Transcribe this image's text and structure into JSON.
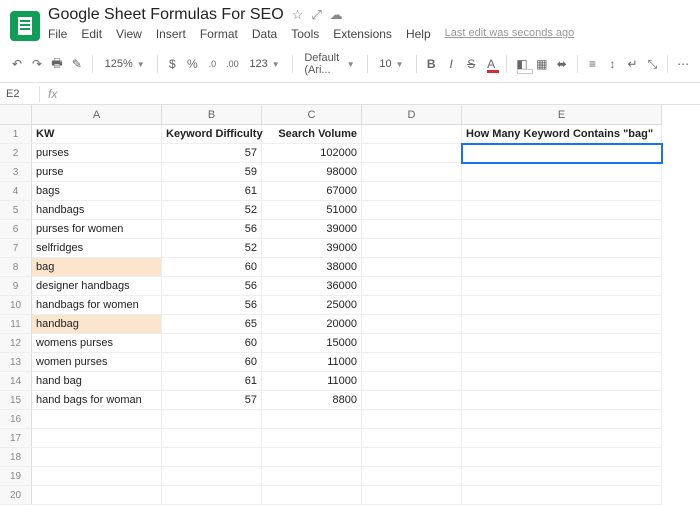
{
  "doc": {
    "title": "Google Sheet Formulas For SEO"
  },
  "menu": {
    "file": "File",
    "edit": "Edit",
    "view": "View",
    "insert": "Insert",
    "format": "Format",
    "data": "Data",
    "tools": "Tools",
    "extensions": "Extensions",
    "help": "Help",
    "last_edit": "Last edit was seconds ago"
  },
  "toolbar": {
    "zoom": "125%",
    "font": "Default (Ari...",
    "size": "10",
    "currency": "$",
    "percent": "%",
    "dec_dec": ".0",
    "inc_dec": ".00",
    "num_fmt": "123",
    "bold": "B",
    "italic": "I",
    "strike": "S",
    "text_color": "A"
  },
  "name_box": "E2",
  "fx": "fx",
  "columns": [
    "A",
    "B",
    "C",
    "D",
    "E"
  ],
  "headers": {
    "a": "KW",
    "b": "Keyword Difficulty",
    "c": "Search Volume",
    "e": "How Many Keyword Contains \"bag\""
  },
  "rows": [
    {
      "kw": "purses",
      "kd": "57",
      "sv": "102000"
    },
    {
      "kw": "purse",
      "kd": "59",
      "sv": "98000"
    },
    {
      "kw": "bags",
      "kd": "61",
      "sv": "67000"
    },
    {
      "kw": "handbags",
      "kd": "52",
      "sv": "51000"
    },
    {
      "kw": "purses for women",
      "kd": "56",
      "sv": "39000"
    },
    {
      "kw": "selfridges",
      "kd": "52",
      "sv": "39000"
    },
    {
      "kw": "bag",
      "kd": "60",
      "sv": "38000",
      "hl": true
    },
    {
      "kw": "designer handbags",
      "kd": "56",
      "sv": "36000"
    },
    {
      "kw": "handbags for women",
      "kd": "56",
      "sv": "25000"
    },
    {
      "kw": "handbag",
      "kd": "65",
      "sv": "20000",
      "hl": true
    },
    {
      "kw": "womens purses",
      "kd": "60",
      "sv": "15000"
    },
    {
      "kw": "women purses",
      "kd": "60",
      "sv": "11000"
    },
    {
      "kw": "hand bag",
      "kd": "61",
      "sv": "11000"
    },
    {
      "kw": "hand bags for woman",
      "kd": "57",
      "sv": "8800"
    }
  ],
  "chart_data": {
    "type": "table",
    "columns": [
      "KW",
      "Keyword Difficulty",
      "Search Volume"
    ],
    "data": [
      [
        "purses",
        57,
        102000
      ],
      [
        "purse",
        59,
        98000
      ],
      [
        "bags",
        61,
        67000
      ],
      [
        "handbags",
        52,
        51000
      ],
      [
        "purses for women",
        56,
        39000
      ],
      [
        "selfridges",
        52,
        39000
      ],
      [
        "bag",
        60,
        38000
      ],
      [
        "designer handbags",
        56,
        36000
      ],
      [
        "handbags for women",
        56,
        25000
      ],
      [
        "handbag",
        65,
        20000
      ],
      [
        "womens purses",
        60,
        15000
      ],
      [
        "women purses",
        60,
        11000
      ],
      [
        "hand bag",
        61,
        11000
      ],
      [
        "hand bags for woman",
        57,
        8800
      ]
    ],
    "question_cell": "How Many Keyword Contains \"bag\""
  }
}
